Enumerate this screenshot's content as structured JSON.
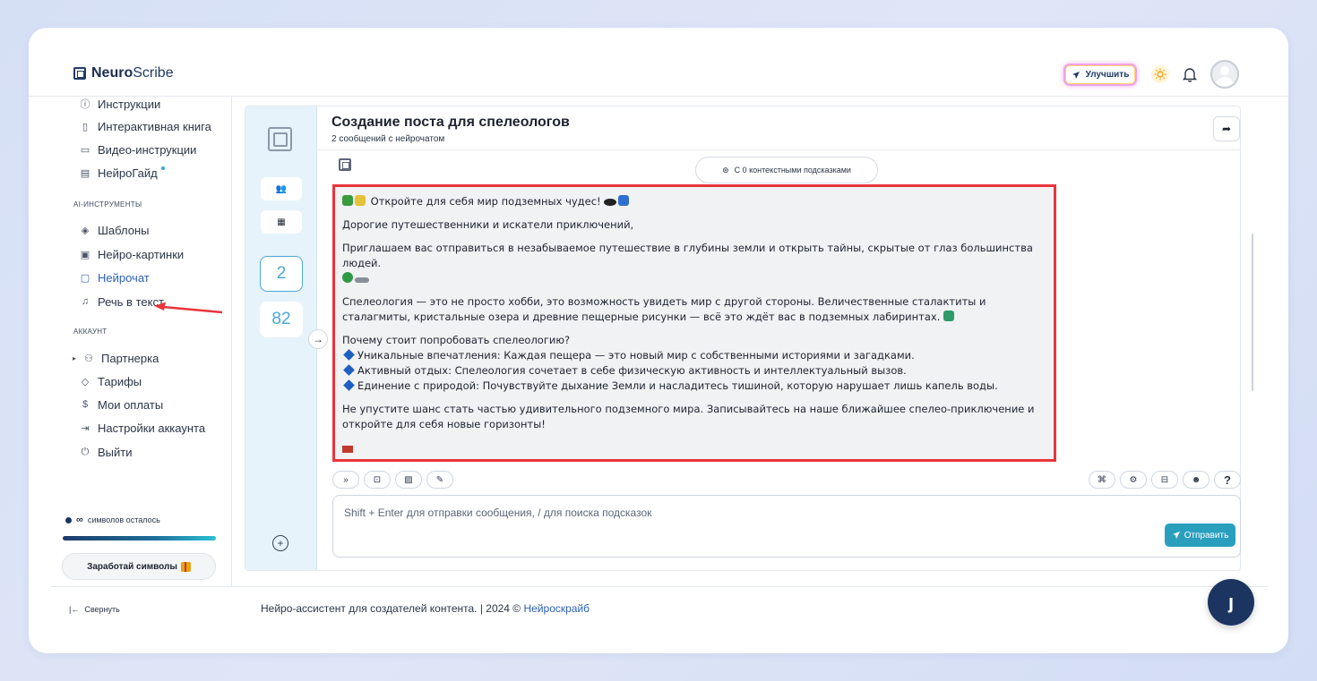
{
  "brand": {
    "name_bold": "Neuro",
    "name_rest": "Scribe"
  },
  "header": {
    "upgrade_label": "Улучшить"
  },
  "sidebar": {
    "help_items": [
      {
        "label": "Инструкции",
        "icon": "help-circle-icon"
      },
      {
        "label": "Интерактивная книга",
        "icon": "book-icon"
      },
      {
        "label": "Видео-инструкции",
        "icon": "video-icon"
      },
      {
        "label": "НейроГайд",
        "icon": "guide-icon"
      }
    ],
    "ai_section_label": "AI-ИНСТРУМЕНТЫ",
    "ai_items": [
      {
        "label": "Шаблоны",
        "icon": "layers-icon"
      },
      {
        "label": "Нейро-картинки",
        "icon": "image-icon"
      },
      {
        "label": "Нейрочат",
        "icon": "chat-icon"
      },
      {
        "label": "Речь в текст",
        "icon": "headphones-icon"
      }
    ],
    "account_section_label": "АККАУНТ",
    "account_items": [
      {
        "label": "Партнерка",
        "icon": "users-icon"
      },
      {
        "label": "Тарифы",
        "icon": "tag-icon"
      },
      {
        "label": "Мои оплаты",
        "icon": "dollar-icon"
      },
      {
        "label": "Настройки аккаунта",
        "icon": "login-icon"
      },
      {
        "label": "Выйти",
        "icon": "power-icon"
      }
    ],
    "credits_symbol": "∞",
    "credits_label": "символов осталось",
    "earn_label": "Заработай символы"
  },
  "rail": {
    "count_a": "2",
    "count_b": "82"
  },
  "chat": {
    "title": "Создание поста для спелеологов",
    "subtitle": "2 сообщений с нейрочатом",
    "hint_pill": "С 0 контекстными подсказками",
    "input_placeholder": "Shift + Enter для отправки сообщения, / для поиска подсказок",
    "send_label": "Отправить",
    "help_label": "?"
  },
  "message": {
    "headline": "Откройте для себя мир подземных чудес!",
    "greeting": "Дорогие путешественники и искатели приключений,",
    "invite": "Приглашаем вас отправиться в незабываемое путешествие в глубины земли и открыть тайны, скрытые от глаз большинства людей.",
    "about": "Спелеология — это не просто хобби, это возможность увидеть мир с другой стороны. Величественные сталактиты и сталагмиты, кристальные озера и древние пещерные рисунки — всё это ждёт вас в подземных лабиринтах.",
    "why": "Почему стоит попробовать спелеологию?",
    "bullets": [
      "Уникальные впечатления: Каждая пещера — это новый мир с собственными историями и загадками.",
      "Активный отдых: Спелеология сочетает в себе физическую активность и интеллектуальный вызов.",
      "Единение с природой: Почувствуйте дыхание Земли и насладитесь тишиной, которую нарушает лишь капель воды."
    ],
    "cta": "Не упустите шанс стать частью удивительного подземного мира. Записывайтесь на наше ближайшее спелео-приключение и откройте для себя новые горизонты!"
  },
  "footer": {
    "collapse_label": "Свернуть",
    "text": "Нейро-ассистент для создателей контента.  | 2024 © ",
    "link": "Нейроскрайб"
  },
  "colors": {
    "accent": "#2a9fbd",
    "highlight_border": "#e9353c",
    "brand_dark": "#1c3560"
  }
}
